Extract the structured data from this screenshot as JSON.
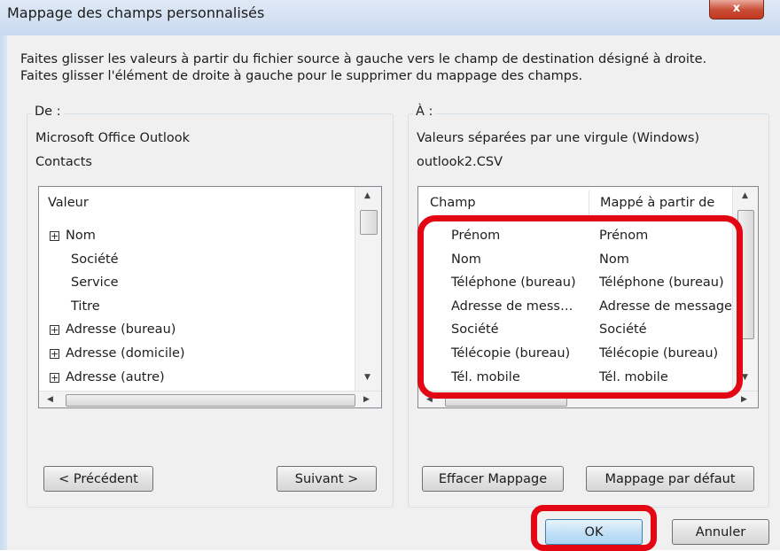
{
  "window": {
    "title": "Mappage des champs personnalisés",
    "close_label": "x"
  },
  "instructions": {
    "line1": "Faites glisser les valeurs à partir du fichier source à gauche vers le champ de destination désigné à droite.",
    "line2": "Faites glisser l'élément de droite à gauche pour le supprimer du mappage des champs."
  },
  "from": {
    "label": "De :",
    "source": "Microsoft Office Outlook",
    "folder": "Contacts",
    "header": "Valeur",
    "items": [
      {
        "label": "Nom",
        "expandable": true
      },
      {
        "label": "Société",
        "expandable": false
      },
      {
        "label": "Service",
        "expandable": false
      },
      {
        "label": "Titre",
        "expandable": false
      },
      {
        "label": "Adresse (bureau)",
        "expandable": true
      },
      {
        "label": "Adresse (domicile)",
        "expandable": true
      },
      {
        "label": "Adresse (autre)",
        "expandable": true
      }
    ],
    "prev_button": "< Précédent",
    "next_button": "Suivant >"
  },
  "to": {
    "label": "À :",
    "target": "Valeurs séparées par une virgule (Windows)",
    "file": "outlook2.CSV",
    "headers": {
      "field": "Champ",
      "mapped": "Mappé à partir de"
    },
    "rows": [
      {
        "field": "Prénom",
        "mapped": "Prénom"
      },
      {
        "field": "Nom",
        "mapped": "Nom"
      },
      {
        "field": "Téléphone (bureau)",
        "mapped": "Téléphone (bureau)"
      },
      {
        "field": "Adresse de mess…",
        "mapped": "Adresse de message"
      },
      {
        "field": "Société",
        "mapped": "Société"
      },
      {
        "field": "Télécopie (bureau)",
        "mapped": "Télécopie (bureau)"
      },
      {
        "field": "Tél. mobile",
        "mapped": "Tél. mobile"
      }
    ],
    "clear_button": "Effacer Mappage",
    "default_button": "Mappage par défaut"
  },
  "footer": {
    "ok": "OK",
    "cancel": "Annuler"
  },
  "colors": {
    "highlight": "#e30613",
    "title_bar": "#c9daf0",
    "dialog_bg": "#f0f0f0"
  }
}
